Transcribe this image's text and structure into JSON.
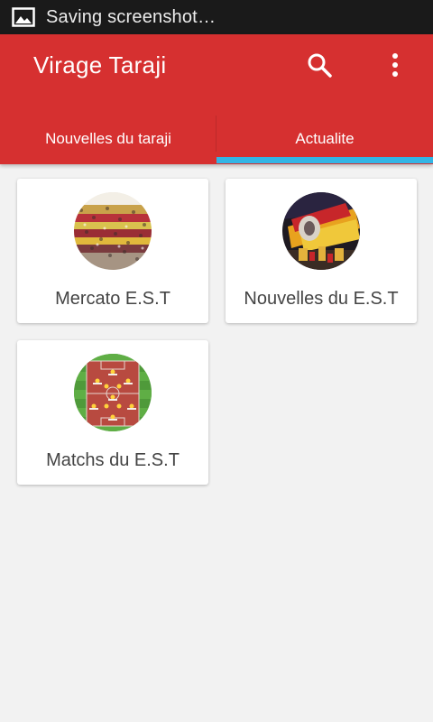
{
  "status_bar": {
    "text": "Saving screenshot…",
    "icon": "image-icon"
  },
  "app_bar": {
    "title": "Virage Taraji",
    "search_icon": "search-icon",
    "overflow_icon": "more-vert-icon",
    "color": "#d63030"
  },
  "tabs": [
    {
      "label": "Nouvelles du taraji",
      "selected": false
    },
    {
      "label": "Actualite",
      "selected": true
    }
  ],
  "tab_indicator_color": "#33b5e5",
  "cards": [
    {
      "label": "Mercato E.S.T",
      "image": "crowd-stands-thumbnail"
    },
    {
      "label": "Nouvelles du E.S.T",
      "image": "fans-tifo-thumbnail"
    },
    {
      "label": "Matchs du E.S.T",
      "image": "lineup-pitch-thumbnail"
    }
  ]
}
